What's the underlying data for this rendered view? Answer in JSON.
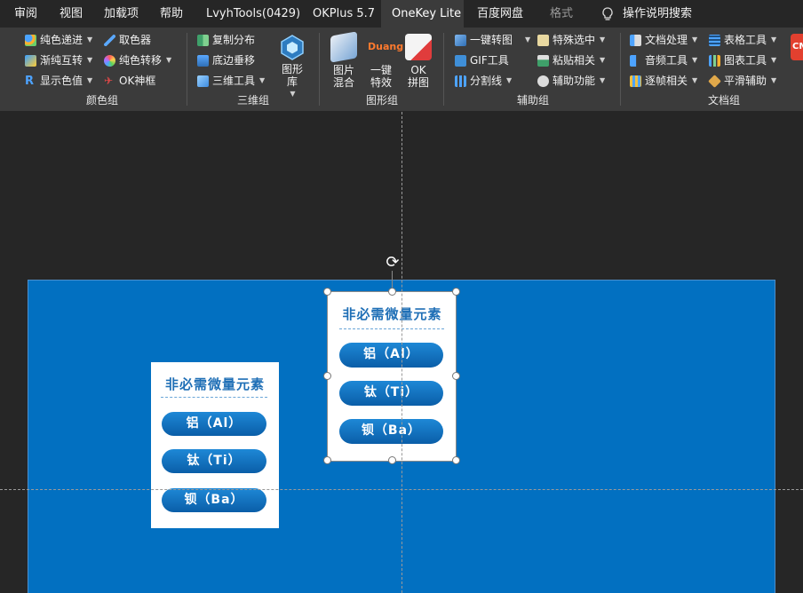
{
  "tabs": [
    "审阅",
    "视图",
    "加载项",
    "帮助",
    "LvyhTools(0429)",
    "OKPlus 5.7",
    "OneKey Lite",
    "百度网盘",
    "格式"
  ],
  "active_tab": "OneKey Lite",
  "search": {
    "label": "操作说明搜索"
  },
  "ribbon": {
    "color_group": {
      "label": "颜色组",
      "items": [
        "纯色递进",
        "渐纯互转",
        "显示色值",
        "取色器",
        "纯色转移",
        "OK神框"
      ]
    },
    "three_d_group": {
      "label": "三维组",
      "items": [
        "复制分布",
        "底边垂移",
        "三维工具"
      ],
      "big": "图形库"
    },
    "shape_group": {
      "label": "图形组",
      "big": [
        "图片混合",
        "一键特效",
        "OK拼图"
      ],
      "duang": "Duang"
    },
    "aux_group": {
      "label": "辅助组",
      "items": [
        "一键转图",
        "GIF工具",
        "分割线",
        "特殊选中",
        "粘贴相关",
        "辅助功能"
      ]
    },
    "doc_group": {
      "label": "文档组",
      "items": [
        "文档处理",
        "音频工具",
        "逐帧相关",
        "表格工具",
        "图表工具",
        "平滑辅助"
      ],
      "big_partial": "CM"
    }
  },
  "slide": {
    "card_left": {
      "title": "非必需微量元素",
      "pills": [
        "铝（Al）",
        "钛（Ti）",
        "钡（Ba）"
      ]
    },
    "card_right": {
      "title": "非必需微量元素",
      "pills": [
        "铝（Al）",
        "钛（Ti）",
        "钡（Ba）"
      ]
    }
  },
  "colors": {
    "slide_bg": "#0270c1",
    "ribbon_bg": "#3b3b3b",
    "tabbar_bg": "#262626",
    "pill": "#1277c6",
    "title": "#1f6fb6"
  }
}
